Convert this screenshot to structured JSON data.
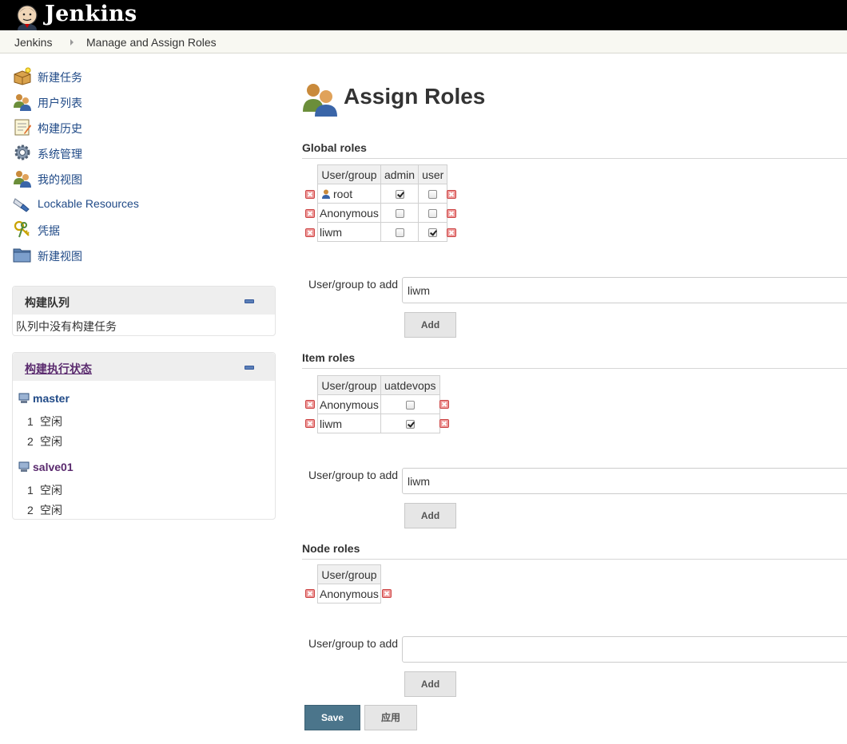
{
  "header": {
    "brand": "Jenkins"
  },
  "breadcrumbs": [
    "Jenkins",
    "Manage and Assign Roles"
  ],
  "sidebar": {
    "tasks": [
      {
        "label": "新建任务",
        "icon": "new-package-icon"
      },
      {
        "label": "用户列表",
        "icon": "users-icon"
      },
      {
        "label": "构建历史",
        "icon": "notepad-icon"
      },
      {
        "label": "系统管理",
        "icon": "gear-icon"
      },
      {
        "label": "我的视图",
        "icon": "users-icon"
      },
      {
        "label": "Lockable Resources",
        "icon": "usb-plug-icon"
      },
      {
        "label": "凭据",
        "icon": "keys-icon"
      },
      {
        "label": "新建视图",
        "icon": "folder-icon"
      }
    ],
    "queue": {
      "title": "构建队列",
      "empty_text": "队列中没有构建任务"
    },
    "executors": {
      "title": "构建执行状态",
      "nodes": [
        {
          "name": "master",
          "rows": [
            {
              "num": "1",
              "state": "空闲"
            },
            {
              "num": "2",
              "state": "空闲"
            }
          ]
        },
        {
          "name": "salve01",
          "rows": [
            {
              "num": "1",
              "state": "空闲"
            },
            {
              "num": "2",
              "state": "空闲"
            }
          ]
        }
      ]
    }
  },
  "main": {
    "title": "Assign Roles",
    "user_group_header": "User/group",
    "add_label": "User/group to add",
    "add_button": "Add",
    "global": {
      "heading": "Global roles",
      "roles": [
        "admin",
        "user"
      ],
      "rows": [
        {
          "name": "root",
          "user_icon": true,
          "checks": [
            true,
            false
          ]
        },
        {
          "name": "Anonymous",
          "checks": [
            false,
            false
          ]
        },
        {
          "name": "liwm",
          "checks": [
            false,
            true
          ]
        }
      ],
      "add_value": "liwm"
    },
    "item": {
      "heading": "Item roles",
      "roles": [
        "uatdevops"
      ],
      "rows": [
        {
          "name": "Anonymous",
          "checks": [
            false
          ]
        },
        {
          "name": "liwm",
          "checks": [
            true
          ]
        }
      ],
      "add_value": "liwm"
    },
    "node": {
      "heading": "Node roles",
      "roles": [],
      "rows": [
        {
          "name": "Anonymous",
          "checks": []
        }
      ],
      "add_value": ""
    },
    "save_button": "Save",
    "apply_button": "应用"
  },
  "colors": {
    "header_bg": "#000000",
    "link": "#204a87",
    "save_bg": "#4b758b"
  }
}
